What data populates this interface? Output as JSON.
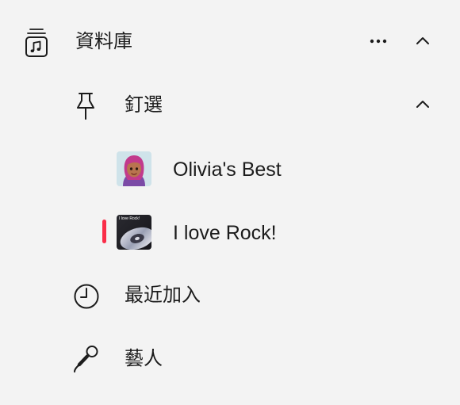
{
  "sidebar": {
    "library": {
      "label": "資料庫",
      "icon": "music-library-icon",
      "more_icon": "more-ellipsis-icon",
      "collapse_icon": "chevron-up-icon"
    },
    "pinned": {
      "label": "釘選",
      "icon": "pin-icon",
      "collapse_icon": "chevron-up-icon",
      "items": [
        {
          "label": "Olivia's Best",
          "artwork": "memoji-avatar-artwork",
          "selected": false
        },
        {
          "label": "I love Rock!",
          "artwork_caption": "I love Rock!",
          "artwork": "vinyl-record-artwork",
          "selected": true
        }
      ]
    },
    "recently_added": {
      "label": "最近加入",
      "icon": "clock-icon"
    },
    "artists": {
      "label": "藝人",
      "icon": "microphone-icon"
    }
  },
  "colors": {
    "background": "#f3f3f3",
    "text": "#1b1b1b",
    "selection_indicator": "#fa2d48"
  }
}
